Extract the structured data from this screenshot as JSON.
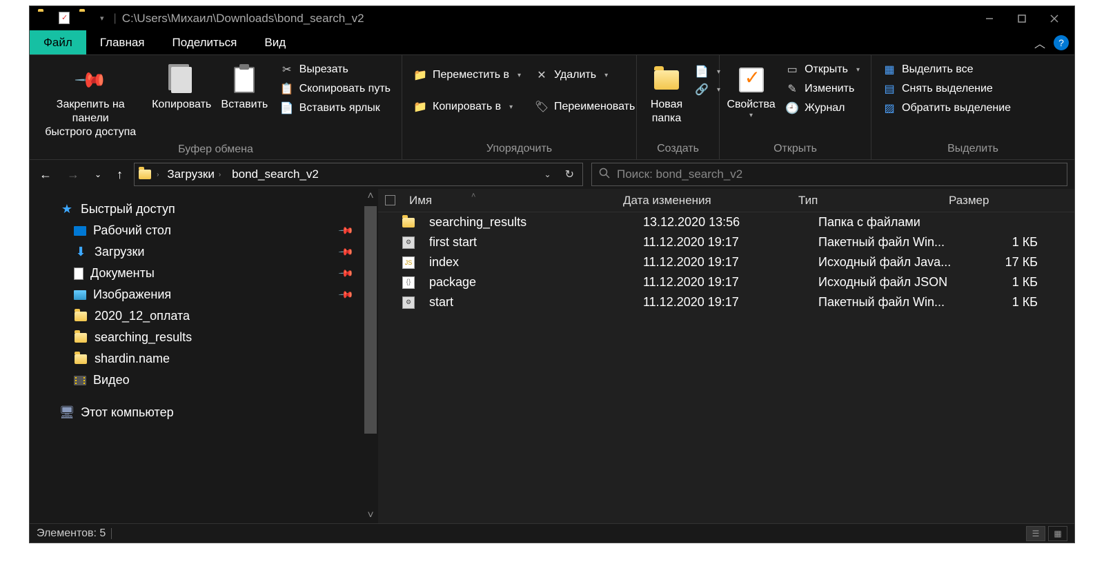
{
  "titlebar": {
    "path": "C:\\Users\\Михаил\\Downloads\\bond_search_v2"
  },
  "tabs": {
    "file": "Файл",
    "home": "Главная",
    "share": "Поделиться",
    "view": "Вид"
  },
  "ribbon": {
    "clipboard": {
      "label": "Буфер обмена",
      "pin": "Закрепить на панели\nбыстрого доступа",
      "copy": "Копировать",
      "paste": "Вставить",
      "cut": "Вырезать",
      "copy_path": "Скопировать путь",
      "paste_shortcut": "Вставить ярлык"
    },
    "organize": {
      "label": "Упорядочить",
      "move_to": "Переместить в",
      "copy_to": "Копировать в",
      "delete": "Удалить",
      "rename": "Переименовать"
    },
    "new": {
      "label": "Создать",
      "new_folder": "Новая\nпапка"
    },
    "open": {
      "label": "Открыть",
      "properties": "Свойства",
      "open": "Открыть",
      "edit": "Изменить",
      "history": "Журнал"
    },
    "select": {
      "label": "Выделить",
      "select_all": "Выделить все",
      "select_none": "Снять выделение",
      "invert": "Обратить выделение"
    }
  },
  "breadcrumb": {
    "downloads": "Загрузки",
    "folder": "bond_search_v2"
  },
  "search": {
    "placeholder": "Поиск: bond_search_v2"
  },
  "sidebar": {
    "quick_access": "Быстрый доступ",
    "desktop": "Рабочий стол",
    "downloads": "Загрузки",
    "documents": "Документы",
    "pictures": "Изображения",
    "item_payment": "2020_12_оплата",
    "item_search": "searching_results",
    "item_shardin": "shardin.name",
    "videos": "Видео",
    "this_pc": "Этот компьютер"
  },
  "columns": {
    "name": "Имя",
    "date": "Дата изменения",
    "type": "Тип",
    "size": "Размер"
  },
  "files": [
    {
      "name": "searching_results",
      "date": "13.12.2020 13:56",
      "type": "Папка с файлами",
      "size": "",
      "icon": "folder"
    },
    {
      "name": "first start",
      "date": "11.12.2020 19:17",
      "type": "Пакетный файл Win...",
      "size": "1 КБ",
      "icon": "bat"
    },
    {
      "name": "index",
      "date": "11.12.2020 19:17",
      "type": "Исходный файл Java...",
      "size": "17 КБ",
      "icon": "js"
    },
    {
      "name": "package",
      "date": "11.12.2020 19:17",
      "type": "Исходный файл JSON",
      "size": "1 КБ",
      "icon": "json"
    },
    {
      "name": "start",
      "date": "11.12.2020 19:17",
      "type": "Пакетный файл Win...",
      "size": "1 КБ",
      "icon": "bat"
    }
  ],
  "status": {
    "elements": "Элементов: 5"
  }
}
